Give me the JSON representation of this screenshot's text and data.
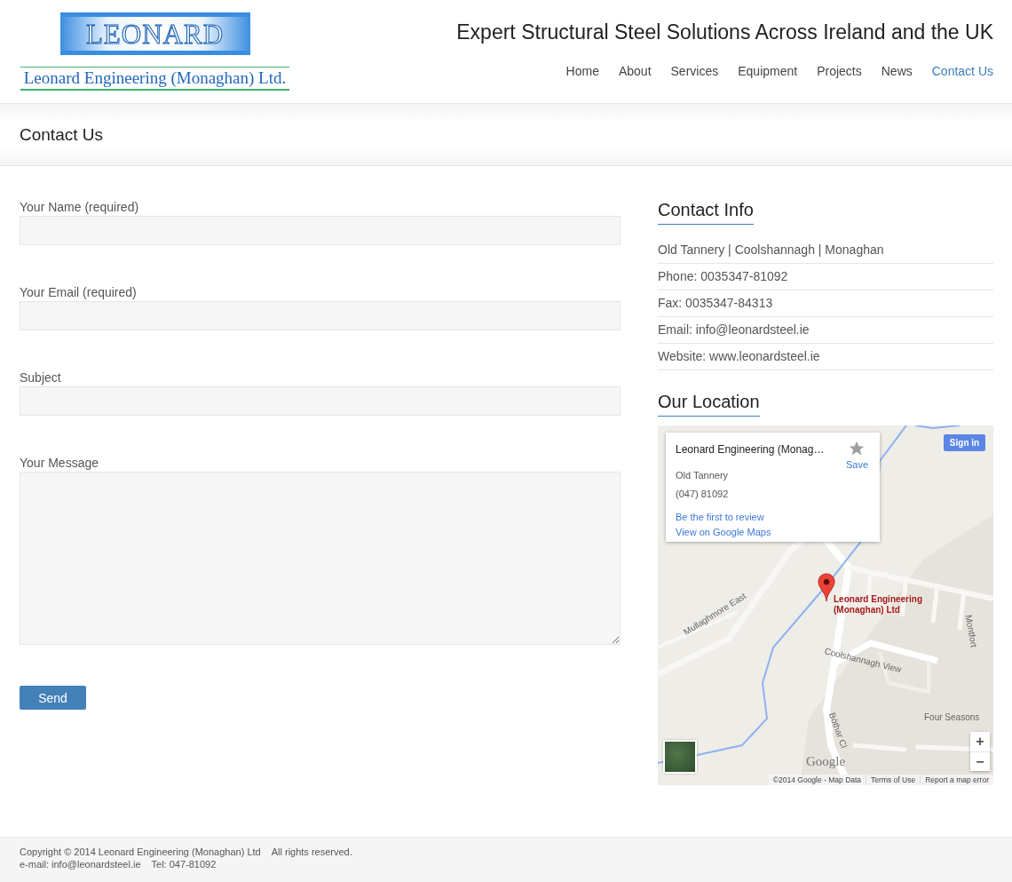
{
  "logo": {
    "wordmark": "LEONARD",
    "company": "Leonard Engineering (Monaghan) Ltd."
  },
  "tagline": "Expert Structural Steel Solutions Across Ireland and the UK",
  "nav": [
    {
      "label": "Home",
      "selected": false
    },
    {
      "label": "About",
      "selected": false
    },
    {
      "label": "Services",
      "selected": false
    },
    {
      "label": "Equipment",
      "selected": false
    },
    {
      "label": "Projects",
      "selected": false
    },
    {
      "label": "News",
      "selected": false
    },
    {
      "label": "Contact Us",
      "selected": true
    }
  ],
  "page_title": "Contact Us",
  "form": {
    "fields": [
      {
        "label": "Your Name (required)",
        "kind": "input"
      },
      {
        "label": "Your Email (required)",
        "kind": "input"
      },
      {
        "label": "Subject",
        "kind": "input"
      },
      {
        "label": "Your Message",
        "kind": "textarea"
      }
    ],
    "submit": "Send"
  },
  "contact_info": {
    "heading": "Contact Info",
    "items": [
      "Old Tannery | Coolshannagh | Monaghan",
      "Phone: 0035347-81092",
      "Fax: 0035347-84313",
      "Email: info@leonardsteel.ie",
      "Website: www.leonardsteel.ie"
    ]
  },
  "location": {
    "heading": "Our Location",
    "map": {
      "info_card": {
        "title": "Leonard Engineering (Monag…",
        "address": "Old Tannery",
        "phone": "(047) 81092",
        "save": "Save",
        "links": [
          "Be the first to review",
          "View on Google Maps"
        ]
      },
      "sign_in": "Sign in",
      "marker_label": [
        "Leonard Engineering",
        "(Monaghan) Ltd"
      ],
      "street_labels": [
        "Mullaghmore East",
        "Coolshannagh View",
        "Montfort",
        "Four Seasons",
        "Bóthar Cl"
      ],
      "logo": "Google",
      "zoom_in": "+",
      "zoom_out": "−",
      "attribution": [
        "©2014 Google - Map Data",
        "Terms of Use",
        "Report a map error"
      ]
    }
  },
  "footer": {
    "lines": [
      [
        "Copyright © 2014 Leonard Engineering (Monaghan) Ltd",
        "All rights reserved."
      ],
      [
        "e-mail: info@leonardsteel.ie",
        "Tel: 047-81092"
      ]
    ]
  }
}
